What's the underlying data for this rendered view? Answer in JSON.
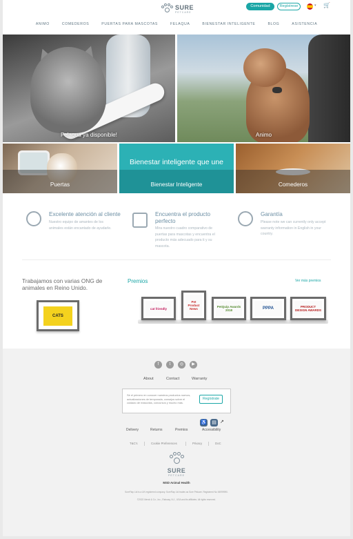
{
  "header": {
    "logo": "SURE",
    "logo_sub": "PETCARE",
    "comunidad": "Comunidad",
    "registrese": "Regístrese",
    "flag_icon": "spain-flag-icon",
    "cart_icon": "cart-icon"
  },
  "nav": [
    "ANIMO",
    "COMEDEROS",
    "PUERTAS PARA MASCOTAS",
    "FELAQUA",
    "BIENESTAR INTELIGENTE",
    "BLOG",
    "ASISTENCIA"
  ],
  "hero": [
    {
      "caption": "Felaqua ya disponible!"
    },
    {
      "caption": "Animo"
    }
  ],
  "tiles": [
    {
      "caption": "Puertas",
      "heading": ""
    },
    {
      "caption": "Bienestar Inteligente",
      "heading": "Bienestar inteligente que une"
    },
    {
      "caption": "Comederos",
      "heading": ""
    }
  ],
  "features": [
    {
      "title": "Excelente atención al cliente",
      "text": "Nuestro equipo de amantes de los animales están encantado de ayudarle.",
      "icon": "headset-icon"
    },
    {
      "title": "Encuentra el producto perfecto",
      "text": "Mira nuestro cuadro comparativo de puertas para mascotas y encuentra el producto más adecuado para ti y su mascota.",
      "icon": "products-icon"
    },
    {
      "title": "Garantía",
      "text": "Please note we can currently only accept warranty information in English in your country.",
      "icon": "warranty-seal-icon"
    }
  ],
  "ong": {
    "title": "Trabajamos con varias ONG de animales en Reino Unido.",
    "sign": "CATS"
  },
  "premios": {
    "title": "Premios",
    "ver_mas": "Ver más premios",
    "awards": [
      "cat friendly",
      "Pet Product News",
      "PetQuip Awards 2018",
      "PPPA",
      "PRODUCT DESIGN AWARDS"
    ]
  },
  "footer": {
    "social_icons": [
      "facebook-icon",
      "twitter-icon",
      "instagram-icon",
      "youtube-icon"
    ],
    "links": [
      "About",
      "Contact",
      "Warranty"
    ],
    "newsletter_text": "Sé el primero en conocer nuestros productos nuevos, actualizaciones de temporada, consejos sobre el cuidado de mascotas, concursos y mucho más.",
    "newsletter_button": "Regístrate",
    "links2": [
      "Delivery",
      "Returns",
      "Premios",
      "Accessibility"
    ],
    "links3": [
      "T&C's",
      "Cookie Preferences",
      "Privacy",
      "DoC"
    ],
    "logo": "SURE",
    "logo_sub": "PETCARE",
    "msd": "MSD Animal Health",
    "legal1": "SureFlap Ltd is a UK registered company. SureFlap Ltd trades as Sure Petcare. Registered No 06999990.",
    "legal2": "©2022 Merck & Co., Inc., Rahway, N.J., USA and its affiliates. All rights reserved."
  }
}
